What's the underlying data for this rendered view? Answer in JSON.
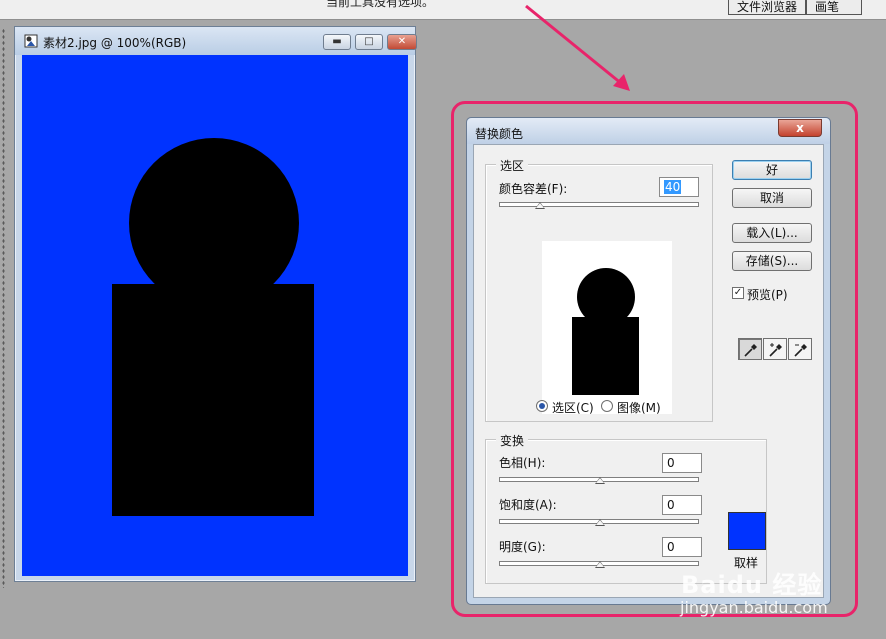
{
  "options_bar": {
    "hint_text": "当前工具没有选项。"
  },
  "palette_tabs": [
    "文件浏览器",
    "画笔"
  ],
  "document": {
    "title": "素材2.jpg @ 100%(RGB)",
    "canvas_color": "#0033ff",
    "shape_color": "#000000"
  },
  "dialog": {
    "title": "替换颜色",
    "close_glyph": "x",
    "selection": {
      "legend": "选区",
      "fuzziness_label": "颜色容差(F):",
      "fuzziness_value": "40",
      "fuzziness_level": 0.2,
      "radio_selection": "选区(C)",
      "radio_image": "图像(M)",
      "selected_radio": "selection"
    },
    "buttons": {
      "ok": "好",
      "cancel": "取消",
      "load": "载入(L)...",
      "save": "存储(S)..."
    },
    "preview": {
      "label": "预览(P)",
      "checked": true
    },
    "eyedroppers": [
      "eyedropper-icon",
      "eyedropper-plus-icon",
      "eyedropper-minus-icon"
    ],
    "transform": {
      "legend": "变换",
      "hue_label": "色相(H):",
      "hue_value": "0",
      "saturation_label": "饱和度(A):",
      "saturation_value": "0",
      "lightness_label": "明度(G):",
      "lightness_value": "0",
      "slider_level": 0.5,
      "sample_label": "取样",
      "sample_color": "#0033ff"
    }
  },
  "annotation": {
    "highlight_color": "#e8246a"
  },
  "watermark": {
    "logo_text": "Baidu 经验",
    "url": "jingyan.baidu.com"
  }
}
